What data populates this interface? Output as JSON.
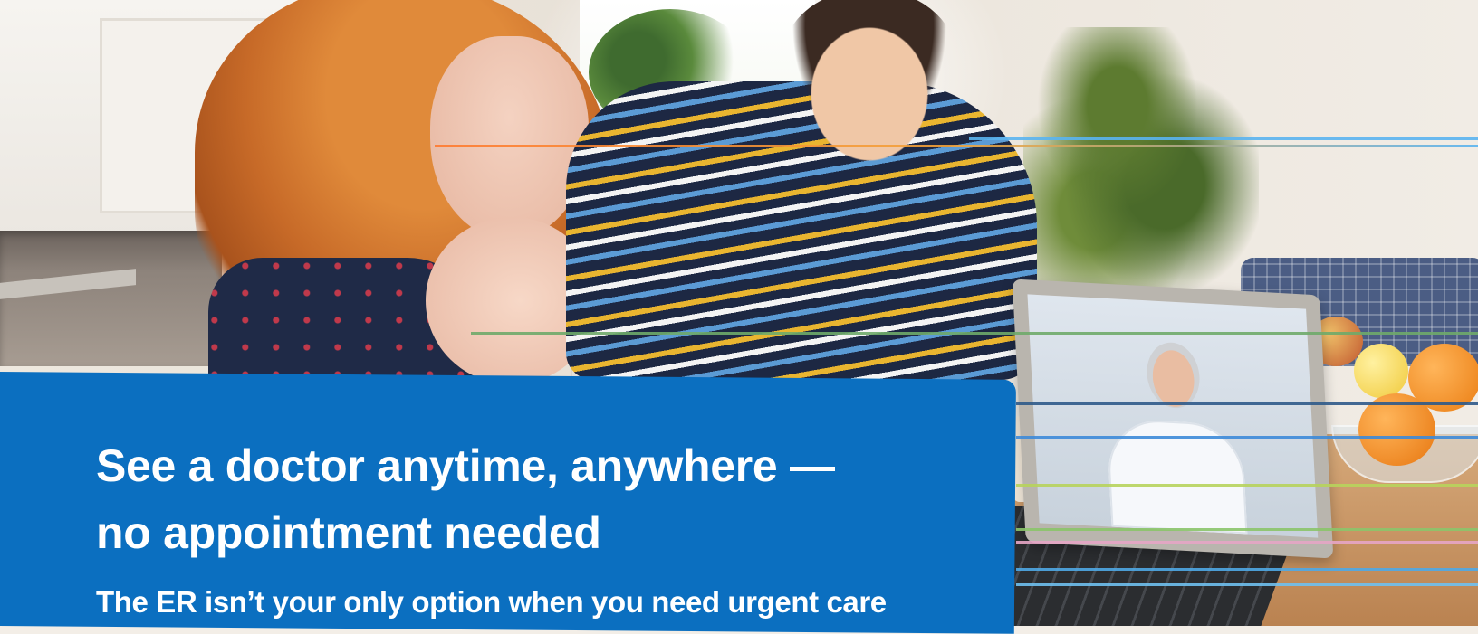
{
  "banner": {
    "headline_line1": "See a doctor anytime, anywhere —",
    "headline_line2": "no appointment needed",
    "subheadline": "The ER isn’t your only option when you need urgent care"
  },
  "colors": {
    "panel_background": "#0b6fc0",
    "headline_text": "#ffffff"
  },
  "photo": {
    "icon": "family-telehealth-photo"
  }
}
